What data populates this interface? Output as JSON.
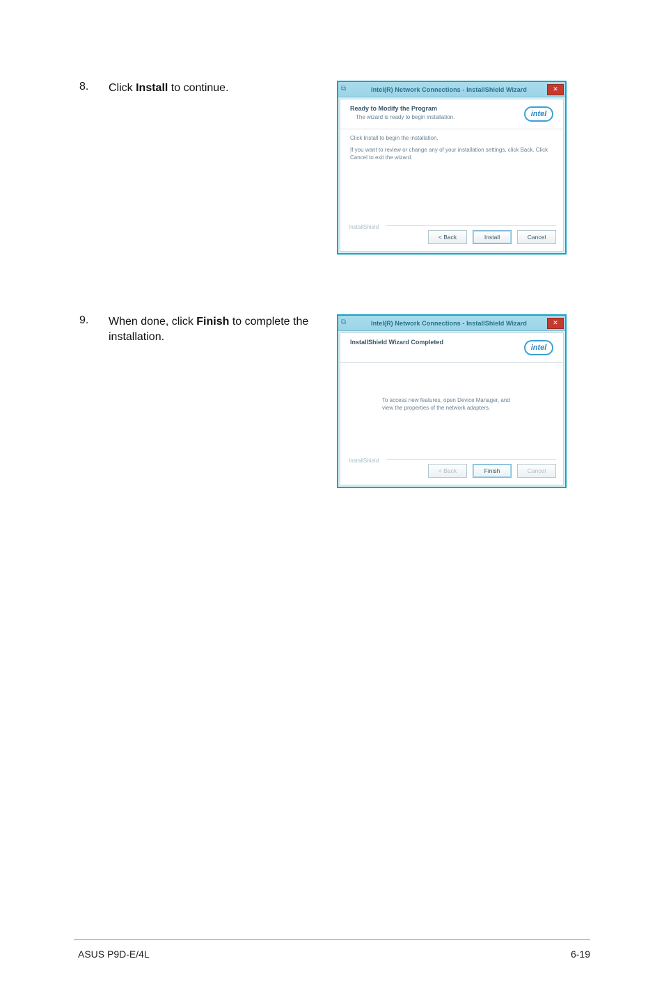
{
  "steps": [
    {
      "num": "8.",
      "pre": "Click ",
      "bold": "Install",
      "post": " to continue."
    },
    {
      "num": "9.",
      "pre": "When done, click ",
      "bold": "Finish",
      "post": " to complete the installation."
    }
  ],
  "dialog1": {
    "titlebar": "Intel(R) Network Connections - InstallShield Wizard",
    "header_title": "Ready to Modify the Program",
    "header_sub": "The wizard is ready to begin installation.",
    "body_line1": "Click Install to begin the installation.",
    "body_line2": "If you want to review or change any of your installation settings, click Back. Click Cancel to exit the wizard.",
    "fieldset_label": "InstallShield",
    "intel_logo": "intel",
    "buttons": {
      "back": "< Back",
      "install": "Install",
      "cancel": "Cancel"
    }
  },
  "dialog2": {
    "titlebar": "Intel(R) Network Connections - InstallShield Wizard",
    "header_title": "InstallShield Wizard Completed",
    "body_msg": "To access new features, open Device Manager, and view the properties of the network adapters.",
    "fieldset_label": "InstallShield",
    "intel_logo": "intel",
    "buttons": {
      "back": "< Back",
      "finish": "Finish",
      "cancel": "Cancel"
    }
  },
  "footer": {
    "left": "ASUS P9D-E/4L",
    "right": "6-19"
  }
}
